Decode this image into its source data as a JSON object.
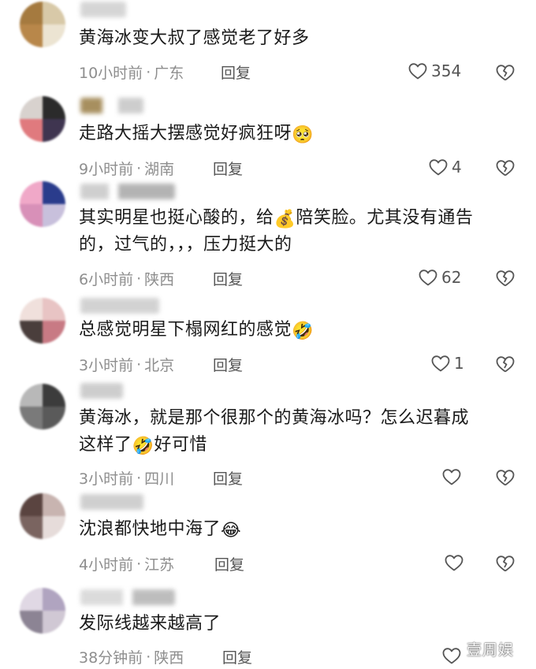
{
  "comments": [
    {
      "text": "黄海冰变大叔了感觉老了好多",
      "emoji": "",
      "time": "10小时前",
      "region": "广东",
      "reply": "回复",
      "likes": "354"
    },
    {
      "text": "走路大摇大摆感觉好疯狂呀",
      "emoji": "🥺",
      "time": "9小时前",
      "region": "湖南",
      "reply": "回复",
      "likes": "4"
    },
    {
      "text_a": "其实明星也挺心酸的，给",
      "emoji": "💰",
      "text_b": "陪笑脸。尤其没有通告",
      "text_line2": "的，过气的，，，压力挺大的",
      "time": "6小时前",
      "region": "陕西",
      "reply": "回复",
      "likes": "62"
    },
    {
      "text": "总感觉明星下榻网红的感觉",
      "emoji": "🤣",
      "time": "3小时前",
      "region": "北京",
      "reply": "回复",
      "likes": "1"
    },
    {
      "text_line1": "黄海冰，就是那个很那个的黄海冰吗？怎么迟暮成",
      "text_a": "这样了",
      "emoji": "🤣",
      "text_b": "好可惜",
      "time": "3小时前",
      "region": "四川",
      "reply": "回复",
      "likes": ""
    },
    {
      "text": "沈浪都快地中海了",
      "emoji": "😂",
      "time": "4小时前",
      "region": "江苏",
      "reply": "回复",
      "likes": ""
    },
    {
      "text": "发际线越来越高了",
      "emoji": "",
      "time": "38分钟前",
      "region": "陕西",
      "reply": "回复",
      "likes": ""
    }
  ],
  "separator": "·",
  "icons": {
    "like": "heart-outline-icon",
    "dislike": "broken-heart-icon"
  },
  "colors": {
    "text": "#1a1a1a",
    "meta": "#8e8e8e",
    "icon": "#555555"
  },
  "watermark": "壹周娱"
}
